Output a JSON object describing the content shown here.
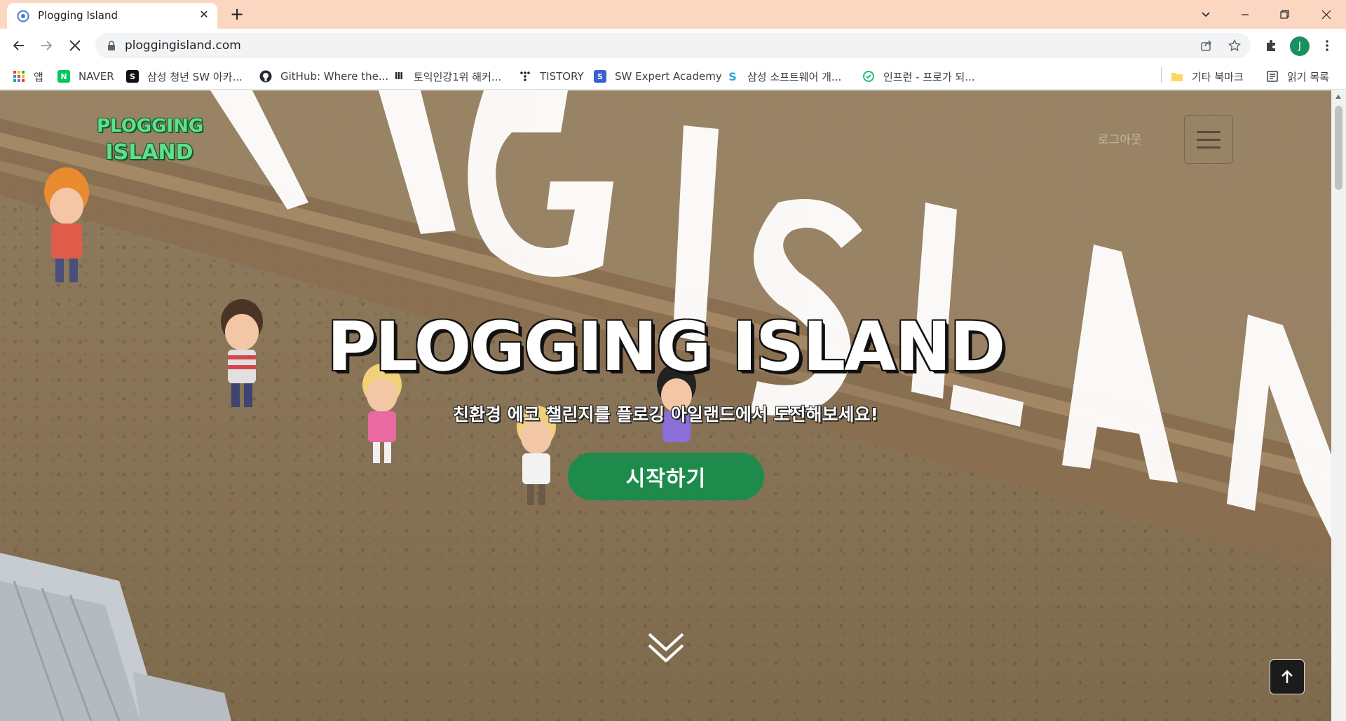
{
  "browser": {
    "tab_title": "Plogging Island",
    "url": "ploggingisland.com",
    "profile_initial": "J"
  },
  "bookmarks": {
    "apps_label": "앱",
    "items": [
      {
        "label": "NAVER",
        "icon": "naver-icon"
      },
      {
        "label": "삼성 청년 SW 아카...",
        "icon": "ssafy-icon"
      },
      {
        "label": "GitHub: Where the...",
        "icon": "github-icon"
      },
      {
        "label": "토익인강1위 해커...",
        "icon": "hackers-icon"
      },
      {
        "label": "TISTORY",
        "icon": "tistory-icon"
      },
      {
        "label": "SW Expert Academy",
        "icon": "swea-icon"
      },
      {
        "label": "삼성 소프트웨어 개...",
        "icon": "samsung-sw-icon"
      },
      {
        "label": "인프런 - 프로가 되...",
        "icon": "inflearn-icon"
      }
    ],
    "other_bookmarks": "기타 북마크",
    "reading_list": "읽기 목록"
  },
  "page": {
    "logo_line1": "PLOGGING",
    "logo_line2": "ISLAND",
    "logout": "로그아웃",
    "hero_title": "PLOGGING ISLAND",
    "hero_subtitle": "친환경 에코 챌린지를 플로깅 아일랜드에서 도전해보세요!",
    "start_button": "시작하기",
    "background_text": "PLOGGING ISLAND"
  },
  "colors": {
    "tab_strip": "#fbd7c2",
    "brand_green": "#1e8b4d",
    "logo_green": "#5fe08a"
  }
}
